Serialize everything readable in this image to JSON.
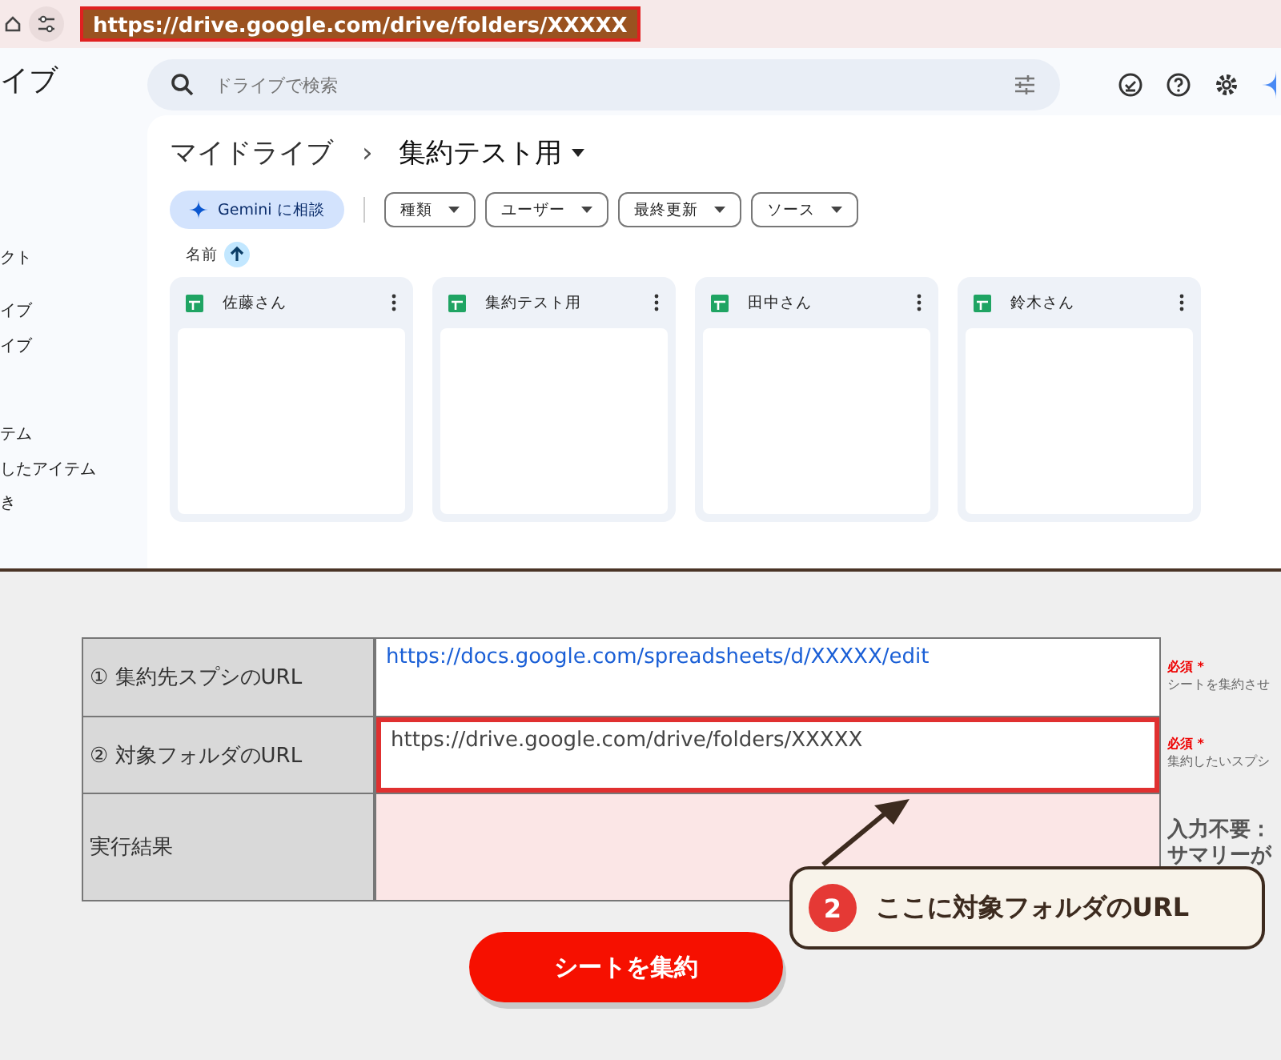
{
  "browser": {
    "url": "https://drive.google.com/drive/folders/XXXXX"
  },
  "drive": {
    "sidebar_title": "イブ",
    "sidebar_items": [
      {
        "label": "クト"
      },
      {
        "label": "イブ"
      },
      {
        "label": "イブ"
      },
      {
        "label": "テム"
      },
      {
        "label": "したアイテム"
      },
      {
        "label": "き"
      }
    ],
    "search": {
      "placeholder": "ドライブで検索"
    },
    "breadcrumb": [
      "マイドライブ",
      "›",
      "集約テスト用"
    ],
    "gemini_button": "Gemini に相談",
    "filters": [
      "種類",
      "ユーザー",
      "最終更新",
      "ソース"
    ],
    "sort_label": "名前",
    "files": [
      {
        "name": "佐藤さん"
      },
      {
        "name": "集約テスト用"
      },
      {
        "name": "田中さん"
      },
      {
        "name": "鈴木さん"
      }
    ]
  },
  "form": {
    "rows": [
      {
        "label": "① 集約先スプシのURL",
        "value": "https://docs.google.com/spreadsheets/d/XXXXX/edit",
        "kind": "link",
        "highlighted": false,
        "required": "必須 *",
        "note": "シートを集約させ"
      },
      {
        "label": "② 対象フォルダのURL",
        "value": "https://drive.google.com/drive/folders/XXXXX",
        "kind": "text",
        "highlighted": true,
        "required": "必須 *",
        "note": "集約したいスプシ"
      },
      {
        "label": "実行結果",
        "kind": "result",
        "highlighted": false,
        "note_lines": [
          "入力不要：",
          "サマリーが"
        ]
      }
    ],
    "submit": "シートを集約"
  },
  "callout": {
    "number": "2",
    "text": "ここに対象フォルダのURL"
  }
}
